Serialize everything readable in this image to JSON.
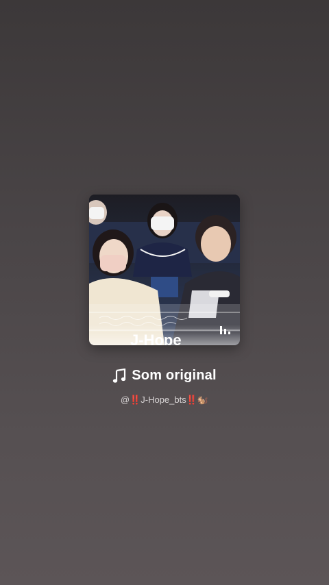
{
  "sound": {
    "title": "Som original",
    "author": "@‼️J-Hope_bts‼️🐿️",
    "cover_overlay_text": "J-Hope",
    "cover_icon": "waveform-bars-icon",
    "title_icon": "music-note-icon"
  },
  "colors": {
    "background_top": "#3c3839",
    "background_bottom": "#5c5557",
    "text_primary": "#ffffff",
    "text_secondary": "#d9d5d6"
  }
}
